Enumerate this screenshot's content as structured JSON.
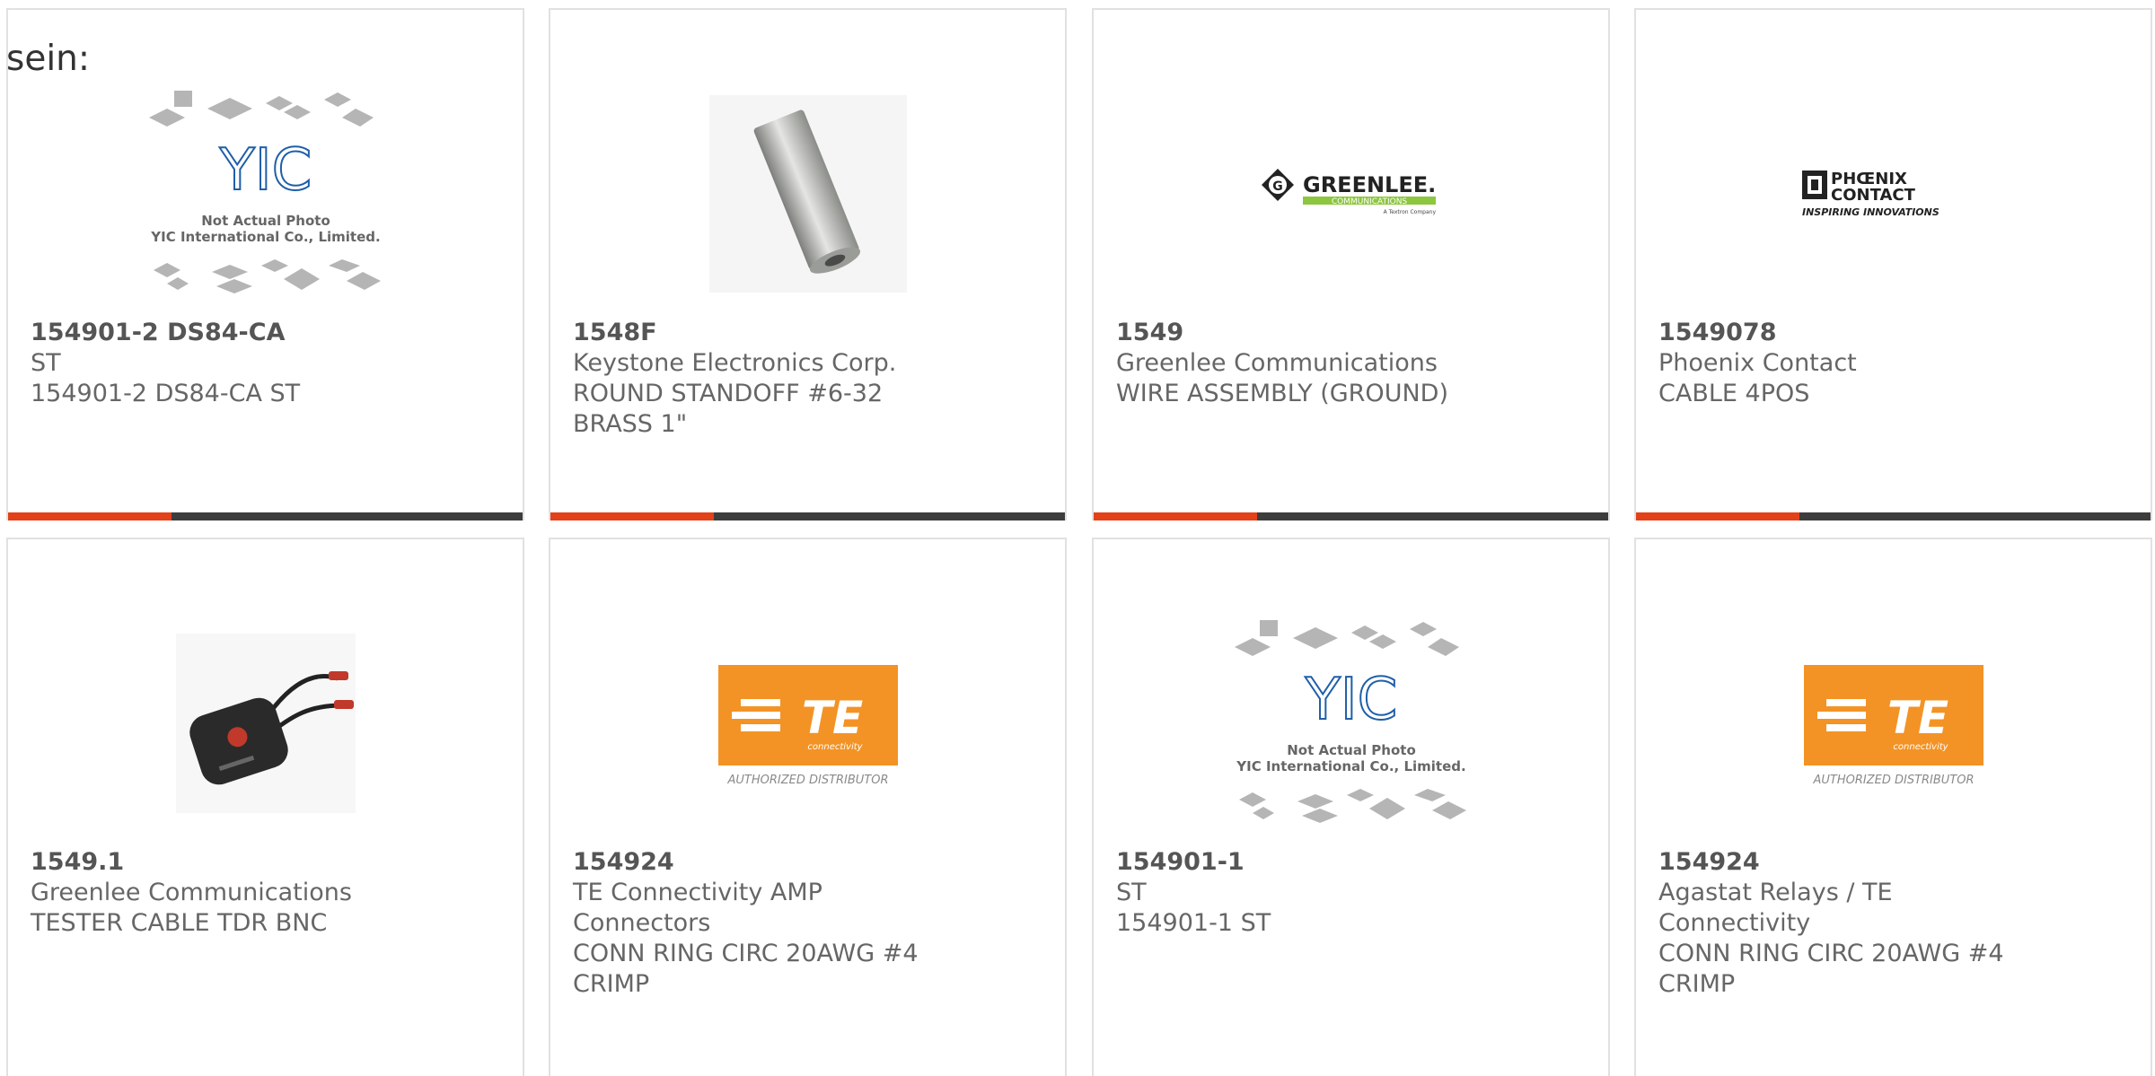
{
  "heading": "sein:",
  "colors": {
    "accent": "#e3411a",
    "bar": "#3d3d3d",
    "te_orange": "#f39325",
    "greenlee_green": "#8dc63f"
  },
  "cards": [
    {
      "part": "154901-2 DS84-CA",
      "maker": "ST",
      "desc": "154901-2 DS84-CA ST",
      "image": "yic-placeholder",
      "image_text": {
        "line1": "Not Actual Photo",
        "line2": "YIC International Co., Limited."
      }
    },
    {
      "part": "1548F",
      "maker": "Keystone Electronics Corp.",
      "desc": "ROUND STANDOFF #6-32 BRASS 1\"",
      "image": "standoff-photo"
    },
    {
      "part": "1549",
      "maker": "Greenlee Communications",
      "desc": "WIRE ASSEMBLY (GROUND)",
      "image": "greenlee-logo",
      "image_text": {
        "line1": "GREENLEE.",
        "line2": "COMMUNICATIONS",
        "line3": "A Textron Company"
      }
    },
    {
      "part": "1549078",
      "maker": "Phoenix Contact",
      "desc": "CABLE 4POS",
      "image": "phoenix-logo",
      "image_text": {
        "line1": "PHŒNIX",
        "line2": "CONTACT",
        "line3": "INSPIRING INNOVATIONS"
      }
    },
    {
      "part": "1549.1",
      "maker": "Greenlee Communications",
      "desc": "TESTER CABLE TDR BNC",
      "image": "tester-photo"
    },
    {
      "part": "154924",
      "maker": "TE Connectivity AMP Connectors",
      "desc": "CONN RING CIRC 20AWG #4 CRIMP",
      "image": "te-logo",
      "image_text": {
        "line1": "TE",
        "line2": "connectivity",
        "line3": "AUTHORIZED DISTRIBUTOR"
      }
    },
    {
      "part": "154901-1",
      "maker": "ST",
      "desc": "154901-1 ST",
      "image": "yic-placeholder",
      "image_text": {
        "line1": "Not Actual Photo",
        "line2": "YIC International Co., Limited."
      }
    },
    {
      "part": "154924",
      "maker": "Agastat Relays / TE Connectivity",
      "desc": "CONN RING CIRC 20AWG #4 CRIMP",
      "image": "te-logo",
      "image_text": {
        "line1": "TE",
        "line2": "connectivity",
        "line3": "AUTHORIZED DISTRIBUTOR"
      }
    }
  ]
}
